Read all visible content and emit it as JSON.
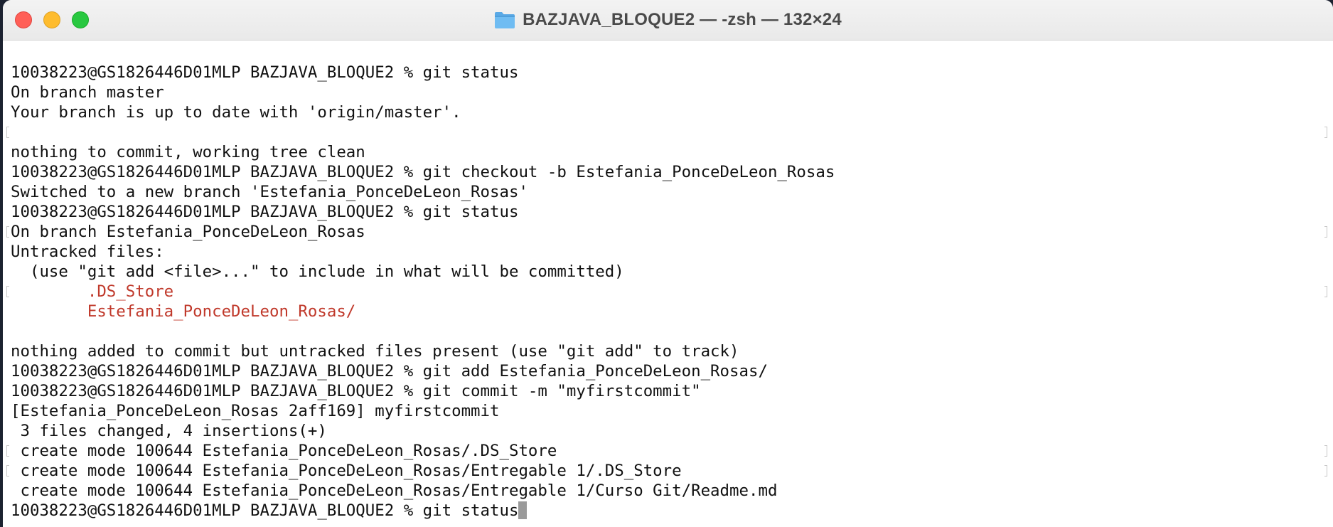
{
  "window": {
    "title": "BAZJAVA_BLOQUE2 — -zsh — 132×24",
    "folder_icon": "folder-icon",
    "colors": {
      "close": "#ff5f57",
      "minimize": "#febc2e",
      "zoom": "#28c840",
      "untracked_text": "#c0392b",
      "cursor": "#9a9a9a"
    }
  },
  "terminal": {
    "lines": [
      {
        "text": "10038223@GS1826446D01MLP BAZJAVA_BLOQUE2 % git status",
        "style": "normal"
      },
      {
        "text": "On branch master",
        "style": "normal"
      },
      {
        "text": "Your branch is up to date with 'origin/master'.",
        "style": "normal"
      },
      {
        "text": "",
        "style": "normal"
      },
      {
        "text": "nothing to commit, working tree clean",
        "style": "normal"
      },
      {
        "text": "10038223@GS1826446D01MLP BAZJAVA_BLOQUE2 % git checkout -b Estefania_PonceDeLeon_Rosas",
        "style": "normal"
      },
      {
        "text": "Switched to a new branch 'Estefania_PonceDeLeon_Rosas'",
        "style": "normal"
      },
      {
        "text": "10038223@GS1826446D01MLP BAZJAVA_BLOQUE2 % git status",
        "style": "normal"
      },
      {
        "text": "On branch Estefania_PonceDeLeon_Rosas",
        "style": "normal"
      },
      {
        "text": "Untracked files:",
        "style": "normal"
      },
      {
        "text": "  (use \"git add <file>...\" to include in what will be committed)",
        "style": "normal"
      },
      {
        "text": "        .DS_Store",
        "style": "red"
      },
      {
        "text": "        Estefania_PonceDeLeon_Rosas/",
        "style": "red"
      },
      {
        "text": "",
        "style": "normal"
      },
      {
        "text": "nothing added to commit but untracked files present (use \"git add\" to track)",
        "style": "normal"
      },
      {
        "text": "10038223@GS1826446D01MLP BAZJAVA_BLOQUE2 % git add Estefania_PonceDeLeon_Rosas/",
        "style": "normal"
      },
      {
        "text": "10038223@GS1826446D01MLP BAZJAVA_BLOQUE2 % git commit -m \"myfirstcommit\"",
        "style": "normal"
      },
      {
        "text": "[Estefania_PonceDeLeon_Rosas 2aff169] myfirstcommit",
        "style": "normal"
      },
      {
        "text": " 3 files changed, 4 insertions(+)",
        "style": "normal"
      },
      {
        "text": " create mode 100644 Estefania_PonceDeLeon_Rosas/.DS_Store",
        "style": "normal"
      },
      {
        "text": " create mode 100644 Estefania_PonceDeLeon_Rosas/Entregable 1/.DS_Store",
        "style": "normal"
      },
      {
        "text": " create mode 100644 Estefania_PonceDeLeon_Rosas/Entregable 1/Curso Git/Readme.md",
        "style": "normal"
      },
      {
        "text": "10038223@GS1826446D01MLP BAZJAVA_BLOQUE2 % git status",
        "style": "normal",
        "cursor": true
      }
    ]
  }
}
